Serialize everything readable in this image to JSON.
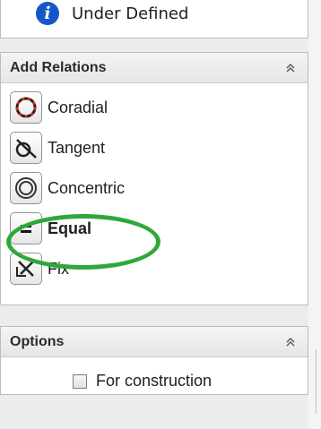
{
  "status": {
    "text": "Under Defined",
    "icon": "info-icon"
  },
  "add_relations": {
    "title": "Add Relations",
    "collapse_icon": "double-chevron-up-icon",
    "items": [
      {
        "label": "Coradial",
        "icon": "coradial-icon",
        "bold": false
      },
      {
        "label": "Tangent",
        "icon": "tangent-icon",
        "bold": false
      },
      {
        "label": "Concentric",
        "icon": "concentric-icon",
        "bold": false
      },
      {
        "label": "Equal",
        "icon": "equal-icon",
        "bold": true
      },
      {
        "label": "Fix",
        "icon": "fix-icon",
        "bold": false
      }
    ],
    "highlight_color": "#2fa83b"
  },
  "options": {
    "title": "Options",
    "collapse_icon": "double-chevron-up-icon",
    "construction_label": "For construction",
    "construction_checked": false
  },
  "colors": {
    "info_icon": "#1557c8",
    "highlight": "#2fa83b"
  }
}
